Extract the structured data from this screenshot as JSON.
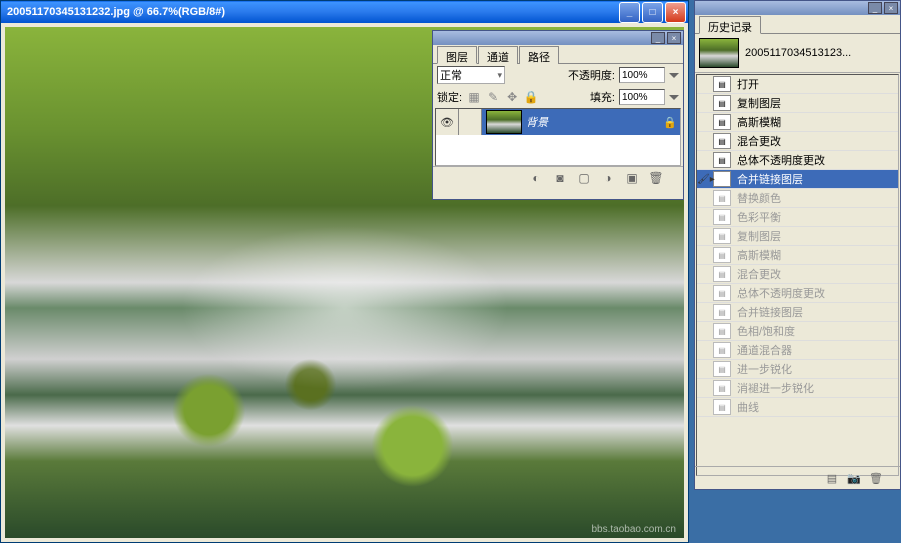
{
  "main_window": {
    "title": "20051170345131232.jpg @ 66.7%(RGB/8#)",
    "watermark": "bbs.taobao.com.cn"
  },
  "layers_panel": {
    "tabs": [
      "图层",
      "通道",
      "路径"
    ],
    "active_tab": 0,
    "blend_label": "正常",
    "opacity_label": "不透明度:",
    "opacity_value": "100%",
    "lock_label": "锁定:",
    "fill_label": "填充:",
    "fill_value": "100%",
    "layers": [
      {
        "name": "背景",
        "visible": true,
        "locked": true
      }
    ]
  },
  "history_panel": {
    "title": "历史记录",
    "snapshot": "2005117034513123...",
    "items": [
      {
        "label": "打开",
        "state": "past"
      },
      {
        "label": "复制图层",
        "state": "past"
      },
      {
        "label": "高斯模糊",
        "state": "past"
      },
      {
        "label": "混合更改",
        "state": "past"
      },
      {
        "label": "总体不透明度更改",
        "state": "past"
      },
      {
        "label": "合并链接图层",
        "state": "current"
      },
      {
        "label": "替换颜色",
        "state": "future"
      },
      {
        "label": "色彩平衡",
        "state": "future"
      },
      {
        "label": "复制图层",
        "state": "future"
      },
      {
        "label": "高斯模糊",
        "state": "future"
      },
      {
        "label": "混合更改",
        "state": "future"
      },
      {
        "label": "总体不透明度更改",
        "state": "future"
      },
      {
        "label": "合并链接图层",
        "state": "future"
      },
      {
        "label": "色相/饱和度",
        "state": "future"
      },
      {
        "label": "通道混合器",
        "state": "future"
      },
      {
        "label": "进一步锐化",
        "state": "future"
      },
      {
        "label": "消褪进一步锐化",
        "state": "future"
      },
      {
        "label": "曲线",
        "state": "future"
      }
    ]
  }
}
